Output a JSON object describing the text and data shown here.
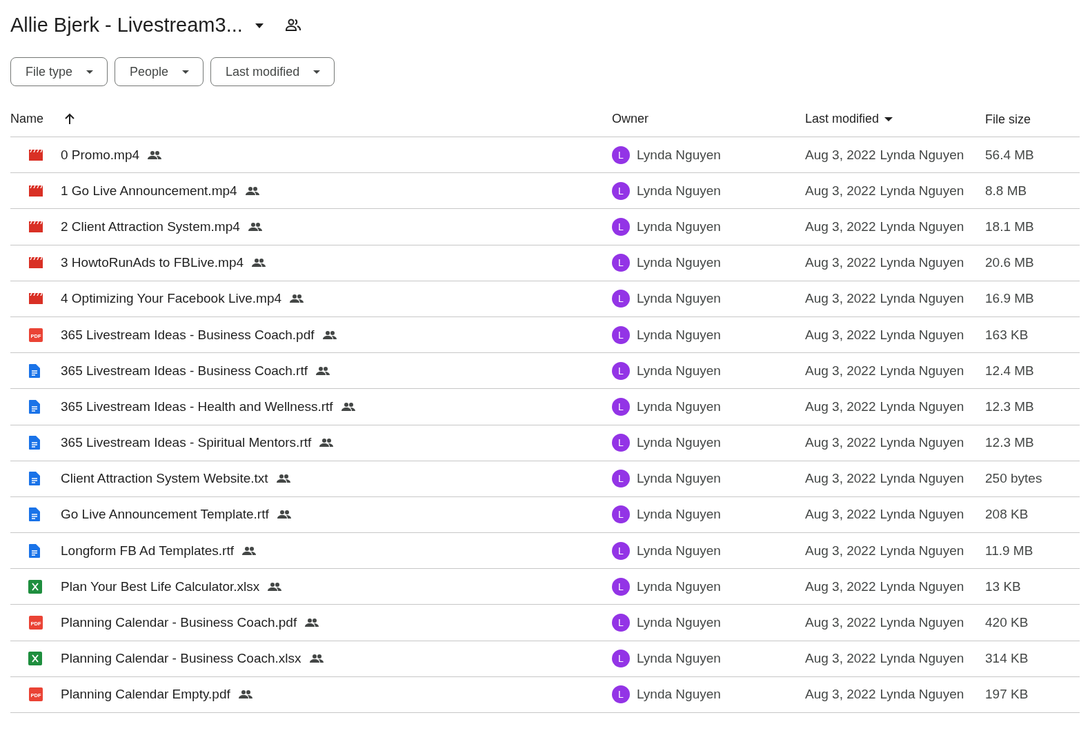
{
  "title": "Allie Bjerk - Livestream3...",
  "filters": [
    {
      "label": "File type"
    },
    {
      "label": "People"
    },
    {
      "label": "Last modified"
    }
  ],
  "columns": {
    "name": "Name",
    "owner": "Owner",
    "modified": "Last modified",
    "size": "File size"
  },
  "rows": [
    {
      "kind": "video",
      "name": "0 Promo.mp4",
      "avatar": "L",
      "owner": "Lynda Nguyen",
      "date": "Aug 3, 2022",
      "modified_by": "Lynda Nguyen",
      "size": "56.4 MB"
    },
    {
      "kind": "video",
      "name": "1 Go Live Announcement.mp4",
      "avatar": "L",
      "owner": "Lynda Nguyen",
      "date": "Aug 3, 2022",
      "modified_by": "Lynda Nguyen",
      "size": "8.8 MB"
    },
    {
      "kind": "video",
      "name": "2 Client Attraction System.mp4",
      "avatar": "L",
      "owner": "Lynda Nguyen",
      "date": "Aug 3, 2022",
      "modified_by": "Lynda Nguyen",
      "size": "18.1 MB"
    },
    {
      "kind": "video",
      "name": "3 HowtoRunAds to FBLive.mp4",
      "avatar": "L",
      "owner": "Lynda Nguyen",
      "date": "Aug 3, 2022",
      "modified_by": "Lynda Nguyen",
      "size": "20.6 MB"
    },
    {
      "kind": "video",
      "name": "4 Optimizing Your Facebook Live.mp4",
      "avatar": "L",
      "owner": "Lynda Nguyen",
      "date": "Aug 3, 2022",
      "modified_by": "Lynda Nguyen",
      "size": "16.9 MB"
    },
    {
      "kind": "pdf",
      "icon_label": "PDF",
      "name": "365 Livestream Ideas - Business Coach.pdf",
      "avatar": "L",
      "owner": "Lynda Nguyen",
      "date": "Aug 3, 2022",
      "modified_by": "Lynda Nguyen",
      "size": "163 KB"
    },
    {
      "kind": "doc",
      "name": "365 Livestream Ideas - Business Coach.rtf",
      "avatar": "L",
      "owner": "Lynda Nguyen",
      "date": "Aug 3, 2022",
      "modified_by": "Lynda Nguyen",
      "size": "12.4 MB"
    },
    {
      "kind": "doc",
      "name": "365 Livestream Ideas - Health and Wellness.rtf",
      "avatar": "L",
      "owner": "Lynda Nguyen",
      "date": "Aug 3, 2022",
      "modified_by": "Lynda Nguyen",
      "size": "12.3 MB"
    },
    {
      "kind": "doc",
      "name": "365 Livestream Ideas - Spiritual Mentors.rtf",
      "avatar": "L",
      "owner": "Lynda Nguyen",
      "date": "Aug 3, 2022",
      "modified_by": "Lynda Nguyen",
      "size": "12.3 MB"
    },
    {
      "kind": "doc",
      "name": "Client Attraction System Website.txt",
      "avatar": "L",
      "owner": "Lynda Nguyen",
      "date": "Aug 3, 2022",
      "modified_by": "Lynda Nguyen",
      "size": "250 bytes"
    },
    {
      "kind": "doc",
      "name": "Go Live Announcement Template.rtf",
      "avatar": "L",
      "owner": "Lynda Nguyen",
      "date": "Aug 3, 2022",
      "modified_by": "Lynda Nguyen",
      "size": "208 KB"
    },
    {
      "kind": "doc",
      "name": "Longform FB Ad Templates.rtf",
      "avatar": "L",
      "owner": "Lynda Nguyen",
      "date": "Aug 3, 2022",
      "modified_by": "Lynda Nguyen",
      "size": "11.9 MB"
    },
    {
      "kind": "sheet",
      "name": "Plan Your Best Life Calculator.xlsx",
      "avatar": "L",
      "owner": "Lynda Nguyen",
      "date": "Aug 3, 2022",
      "modified_by": "Lynda Nguyen",
      "size": "13 KB"
    },
    {
      "kind": "pdf",
      "icon_label": "PDF",
      "name": "Planning Calendar - Business Coach.pdf",
      "avatar": "L",
      "owner": "Lynda Nguyen",
      "date": "Aug 3, 2022",
      "modified_by": "Lynda Nguyen",
      "size": "420 KB"
    },
    {
      "kind": "sheet",
      "name": "Planning Calendar - Business Coach.xlsx",
      "avatar": "L",
      "owner": "Lynda Nguyen",
      "date": "Aug 3, 2022",
      "modified_by": "Lynda Nguyen",
      "size": "314 KB"
    },
    {
      "kind": "pdf",
      "icon_label": "PDF",
      "name": "Planning Calendar Empty.pdf",
      "avatar": "L",
      "owner": "Lynda Nguyen",
      "date": "Aug 3, 2022",
      "modified_by": "Lynda Nguyen",
      "size": "197 KB"
    }
  ]
}
